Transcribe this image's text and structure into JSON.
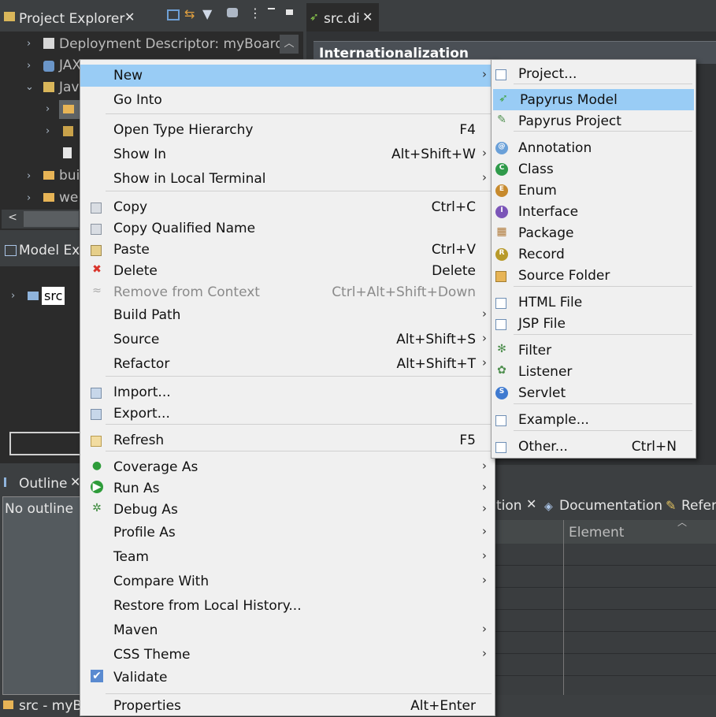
{
  "project_explorer": {
    "title": "Project Explorer",
    "tree": [
      "Deployment Descriptor: myBoard",
      "JAX",
      "Jav",
      "bui",
      "we"
    ]
  },
  "model_explorer": {
    "title": "Model Ex",
    "item": "src"
  },
  "outline": {
    "title": "Outline",
    "empty_text": "No outline"
  },
  "editor": {
    "tab": "src.di",
    "section_title": "Internationalization"
  },
  "bottom_tabs": {
    "partial": "tion",
    "documentation": "Documentation",
    "references": "Refer",
    "column_element": "Element"
  },
  "status": {
    "text": "src - myB"
  },
  "context_menu": {
    "items": [
      {
        "label": "New",
        "shortcut": "",
        "submenu": true,
        "highlight": true
      },
      {
        "label": "Go Into"
      },
      {
        "label": "Open Type Hierarchy",
        "shortcut": "F4"
      },
      {
        "label": "Show In",
        "shortcut": "Alt+Shift+W",
        "submenu": true
      },
      {
        "label": "Show in Local Terminal",
        "submenu": true
      },
      {
        "label": "Copy",
        "shortcut": "Ctrl+C",
        "icon": "copy-icon"
      },
      {
        "label": "Copy Qualified Name",
        "icon": "copy-qualified-icon"
      },
      {
        "label": "Paste",
        "shortcut": "Ctrl+V",
        "icon": "paste-icon"
      },
      {
        "label": "Delete",
        "shortcut": "Delete",
        "icon": "delete-icon"
      },
      {
        "label": "Remove from Context",
        "shortcut": "Ctrl+Alt+Shift+Down",
        "disabled": true,
        "icon": "remove-context-icon"
      },
      {
        "label": "Build Path",
        "submenu": true
      },
      {
        "label": "Source",
        "shortcut": "Alt+Shift+S",
        "submenu": true
      },
      {
        "label": "Refactor",
        "shortcut": "Alt+Shift+T",
        "submenu": true
      },
      {
        "label": "Import...",
        "icon": "import-icon"
      },
      {
        "label": "Export...",
        "icon": "export-icon"
      },
      {
        "label": "Refresh",
        "shortcut": "F5",
        "icon": "refresh-icon"
      },
      {
        "label": "Coverage As",
        "submenu": true,
        "icon": "coverage-icon"
      },
      {
        "label": "Run As",
        "submenu": true,
        "icon": "run-icon"
      },
      {
        "label": "Debug As",
        "submenu": true,
        "icon": "debug-icon"
      },
      {
        "label": "Profile As",
        "submenu": true
      },
      {
        "label": "Team",
        "submenu": true
      },
      {
        "label": "Compare With",
        "submenu": true
      },
      {
        "label": "Restore from Local History..."
      },
      {
        "label": "Maven",
        "submenu": true
      },
      {
        "label": "CSS Theme",
        "submenu": true
      },
      {
        "label": "Validate",
        "icon": "validate-check-icon"
      },
      {
        "label": "Properties",
        "shortcut": "Alt+Enter"
      }
    ]
  },
  "new_submenu": {
    "items": [
      {
        "label": "Project...",
        "icon": "project-icon"
      },
      {
        "label": "Papyrus Model",
        "highlight": true,
        "icon": "papyrus-model-icon"
      },
      {
        "label": "Papyrus Project",
        "icon": "papyrus-project-icon"
      },
      {
        "label": "Annotation",
        "icon": "annotation-icon",
        "glyph": "@"
      },
      {
        "label": "Class",
        "icon": "class-icon",
        "glyph": "C"
      },
      {
        "label": "Enum",
        "icon": "enum-icon",
        "glyph": "E"
      },
      {
        "label": "Interface",
        "icon": "interface-icon",
        "glyph": "I"
      },
      {
        "label": "Package",
        "icon": "package-icon"
      },
      {
        "label": "Record",
        "icon": "record-icon",
        "glyph": "R"
      },
      {
        "label": "Source Folder",
        "icon": "source-folder-icon"
      },
      {
        "label": "HTML File",
        "icon": "html-file-icon"
      },
      {
        "label": "JSP File",
        "icon": "jsp-file-icon"
      },
      {
        "label": "Filter",
        "icon": "filter-icon"
      },
      {
        "label": "Listener",
        "icon": "listener-icon"
      },
      {
        "label": "Servlet",
        "icon": "servlet-icon",
        "glyph": "S"
      },
      {
        "label": "Example...",
        "icon": "example-icon"
      },
      {
        "label": "Other...",
        "shortcut": "Ctrl+N",
        "icon": "other-icon"
      }
    ]
  },
  "colors": {
    "highlight": "#99ccf5",
    "menu_bg": "#f0f0f0",
    "ide_bg": "#3c3f41"
  }
}
